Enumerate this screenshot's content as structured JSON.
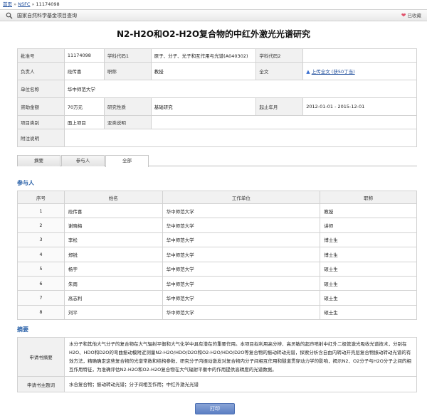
{
  "breadcrumb": {
    "home": "首页",
    "sep1": "»",
    "nsfc": "NSFC",
    "sep2": "»",
    "current": "11174098"
  },
  "header_bar": {
    "title": "国家自然科学基金项目查询",
    "favorite": "已收藏"
  },
  "page_title": "N2-H2O和O2-H2O复合物的中红外激光光谱研究",
  "info": {
    "approval_no_label": "批准号",
    "approval_no": "11174098",
    "code1_label": "学科代码1",
    "code1": "原子、分子、光子和互作用与光谱(A040302)",
    "code2_label": "学科代码2",
    "code2": "",
    "leader_label": "负责人",
    "leader": "段传喜",
    "title_label": "职称",
    "title_value": "教授",
    "fulltext_label": "全文",
    "fulltext_link": "上传全文 (获50丁当)",
    "unit_label": "单位名称",
    "unit": "华中师范大学",
    "funding_label": "资助金额",
    "funding": "70万元",
    "nature_label": "研究性质",
    "nature": "基础研究",
    "period_label": "起止年月",
    "period": "2012-01-01 - 2015-12-01",
    "category_label": "项目类别",
    "category": "面上项目",
    "subcat_label": "亚类说明",
    "subcat": "",
    "note_label": "附注说明",
    "note": ""
  },
  "tabs": [
    "摘要",
    "参与人",
    "全部"
  ],
  "active_tab": "全部",
  "participants_section": "参与人",
  "participants": {
    "headers": [
      "序号",
      "姓名",
      "工作单位",
      "职称"
    ],
    "rows": [
      [
        "1",
        "段传喜",
        "华中师范大学",
        "教授"
      ],
      [
        "2",
        "谢晓梅",
        "华中师范大学",
        "讲师"
      ],
      [
        "3",
        "李松",
        "华中师范大学",
        "博士生"
      ],
      [
        "4",
        "郑锐",
        "华中师范大学",
        "博士生"
      ],
      [
        "5",
        "杨宇",
        "华中师范大学",
        "硕士生"
      ],
      [
        "6",
        "朱雨",
        "华中师范大学",
        "硕士生"
      ],
      [
        "7",
        "高志利",
        "华中师范大学",
        "硕士生"
      ],
      [
        "8",
        "刘平",
        "华中师范大学",
        "硕士生"
      ]
    ]
  },
  "abstract_section": "摘要",
  "abstract": {
    "summary_label": "申请书摘要",
    "summary": "水分子和其他大气分子的复合物在大气辐射平衡和大气化学中具有潜在的重要作用。本项目拟利用高分辨、高灵敏的超声喷射中红外二极管激光吸收光谱技术，分别在H2O、HDO和D2O的弯曲振动模附近测量N2-H2O/HDO/D2O和O2-H2O/HDO/D2O等复合物的振动转动光谱，探索分析含自由内转动开壳层复合物振动转动光谱的有效方法，精确确定这些复合物的光谱常数和结构参数，研究分子内振动激发对复合物内分子间相互作用和隧道贯穿动力学的影响，揭示N2、O2分子与H2O分子之间的相互作用特征，为准确评估N2-H2O和O2-H2O复合物在大气辐射平衡中的作用提供高精度的光谱数据。",
    "keywords_label": "申请书主题词",
    "keywords": "水合复合物；振动转动光谱；分子间相互作用；中红外激光光谱"
  },
  "print_button": "打印",
  "colors": {
    "section": "#2b62a9",
    "link": "#1a4a9a",
    "label_bg": "#f1f1f1"
  }
}
